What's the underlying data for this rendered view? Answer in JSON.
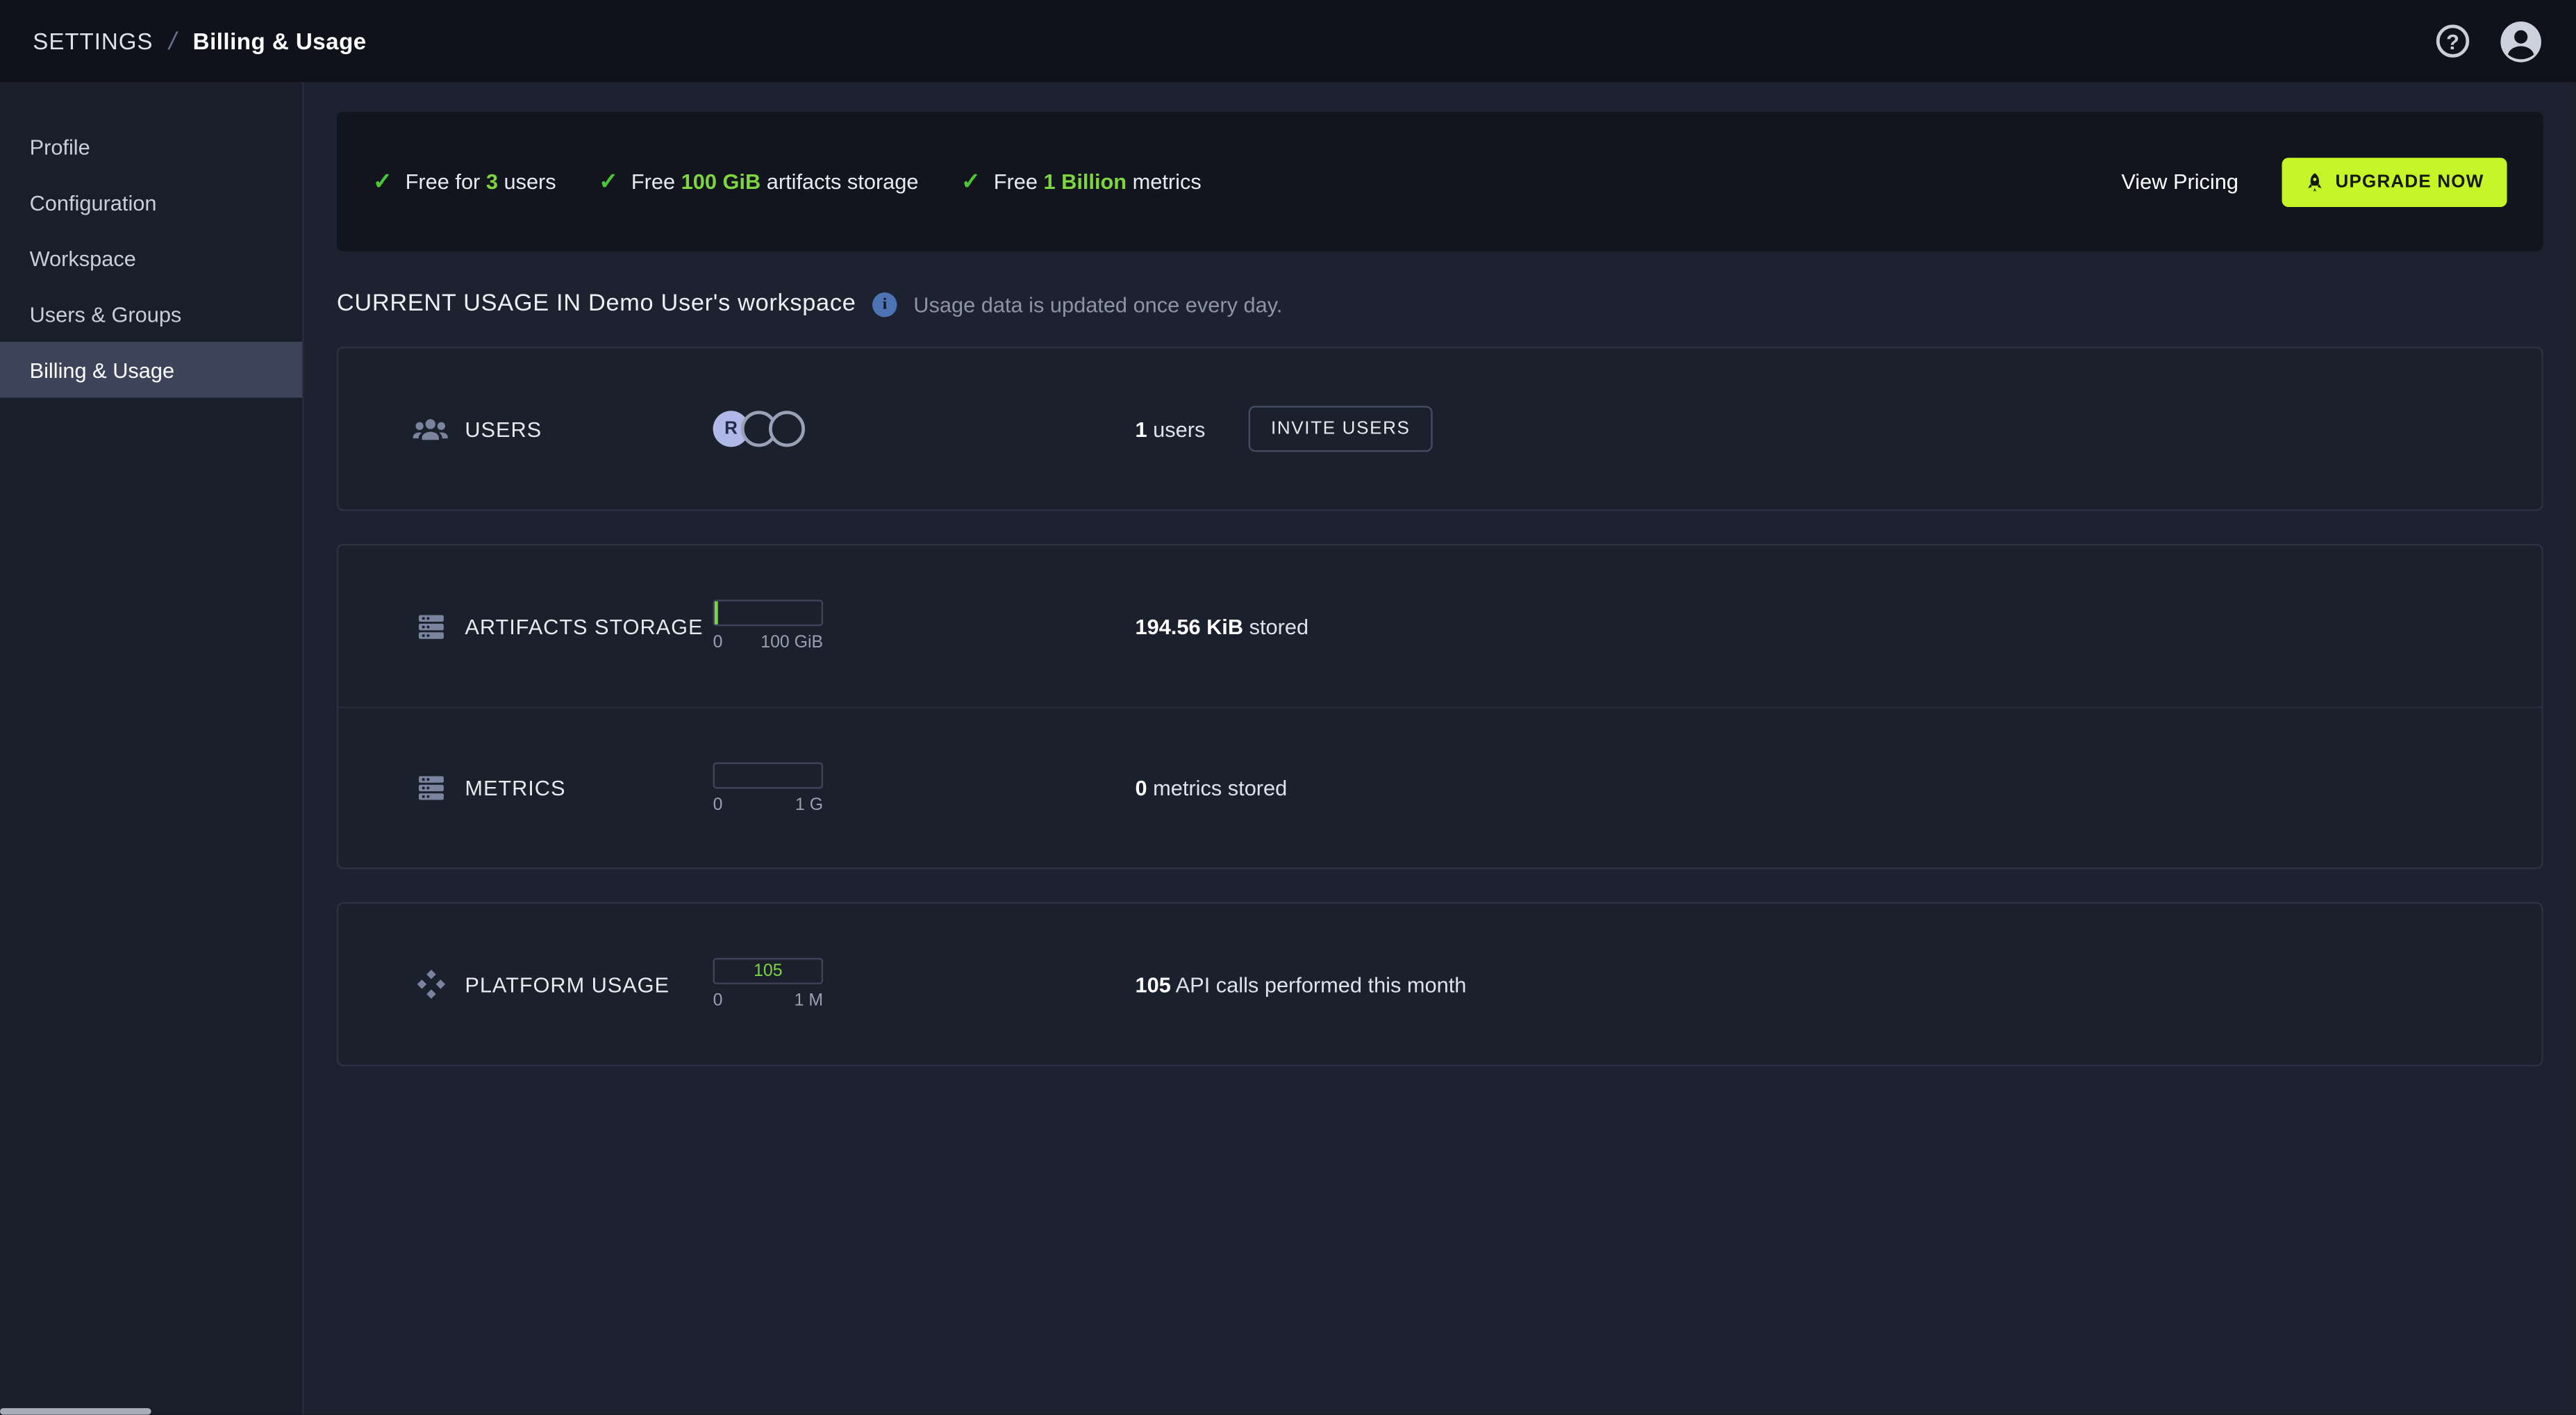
{
  "topbar": {
    "breadcrumb_section": "SETTINGS",
    "breadcrumb_separator": "/",
    "breadcrumb_page": "Billing & Usage",
    "help_glyph": "?"
  },
  "sidebar": {
    "items": [
      {
        "label": "Profile",
        "active": false
      },
      {
        "label": "Configuration",
        "active": false
      },
      {
        "label": "Workspace",
        "active": false
      },
      {
        "label": "Users & Groups",
        "active": false
      },
      {
        "label": "Billing & Usage",
        "active": true
      }
    ]
  },
  "banner": {
    "features": [
      {
        "prefix": "Free for ",
        "highlight": "3",
        "suffix": " users"
      },
      {
        "prefix": "Free ",
        "highlight": "100 GiB",
        "suffix": " artifacts storage"
      },
      {
        "prefix": "Free ",
        "highlight": "1 Billion",
        "suffix": " metrics"
      }
    ],
    "view_pricing_label": "View Pricing",
    "upgrade_label": "UPGRADE NOW"
  },
  "usage": {
    "section_title": "CURRENT USAGE IN Demo User's workspace",
    "info_glyph": "i",
    "note": "Usage data is updated once every day.",
    "cards": {
      "users": {
        "label": "USERS",
        "avatar_initial": "R",
        "value": "1",
        "value_suffix": " users",
        "invite_label": "INVITE USERS"
      },
      "artifacts": {
        "label": "ARTIFACTS STORAGE",
        "scale_min": "0",
        "scale_max": "100 GiB",
        "value": "194.56 KiB",
        "value_suffix": " stored"
      },
      "metrics": {
        "label": "METRICS",
        "scale_min": "0",
        "scale_max": "1 G",
        "value": "0",
        "value_suffix": " metrics stored"
      },
      "platform": {
        "label": "PLATFORM USAGE",
        "scale_min": "0",
        "scale_max": "1 M",
        "bar_label": "105",
        "value": "105",
        "value_suffix": " API calls performed this month"
      }
    }
  },
  "colors": {
    "check_green": "#49c933",
    "accent_green": "#7dd63f",
    "upgrade_button": "#c5f527",
    "info_blue": "#4e73b4",
    "avatar_lavender": "#b0b8e8",
    "topbar_bg": "#0f121b",
    "page_bg": "#1d2230",
    "card_bg": "#1b202d"
  }
}
